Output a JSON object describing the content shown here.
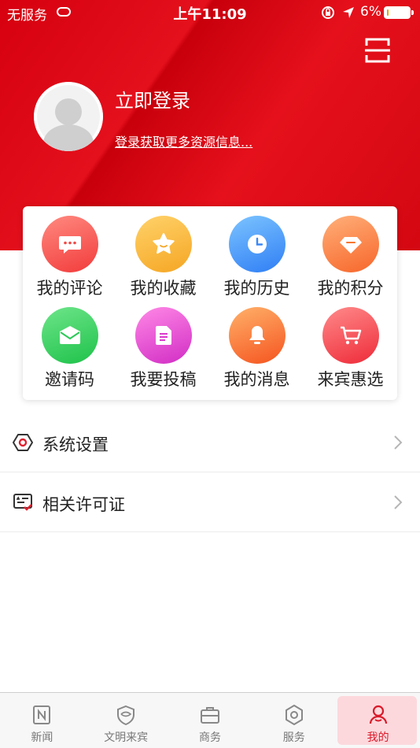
{
  "status_bar": {
    "carrier": "无服务",
    "time": "上午11:09",
    "battery": "6%",
    "battery_level": 0.06
  },
  "header": {
    "login_title": "立即登录",
    "login_subtitle": "登录获取更多资源信息...",
    "scan_icon": "scan-icon",
    "avatar_icon": "default-avatar-icon"
  },
  "shortcuts": [
    {
      "label": "我的评论",
      "icon": "comment-icon",
      "colors": [
        "#ff8a80",
        "#f23b3b"
      ]
    },
    {
      "label": "我的收藏",
      "icon": "star-icon",
      "colors": [
        "#ffd26a",
        "#f5a623"
      ]
    },
    {
      "label": "我的历史",
      "icon": "clock-icon",
      "colors": [
        "#7cc4ff",
        "#2f7ef5"
      ]
    },
    {
      "label": "我的积分",
      "icon": "diamond-icon",
      "colors": [
        "#ffb07a",
        "#f7662a"
      ]
    },
    {
      "label": "邀请码",
      "icon": "envelope-icon",
      "colors": [
        "#6ee58a",
        "#1ec24a"
      ]
    },
    {
      "label": "我要投稿",
      "icon": "document-icon",
      "colors": [
        "#ff88e6",
        "#d12dc4"
      ]
    },
    {
      "label": "我的消息",
      "icon": "bell-icon",
      "colors": [
        "#ffb16a",
        "#f5541f"
      ]
    },
    {
      "label": "来宾惠选",
      "icon": "cart-icon",
      "colors": [
        "#ff8a8a",
        "#ee2b39"
      ]
    }
  ],
  "menu": [
    {
      "label": "系统设置",
      "icon": "settings-hexagon-icon"
    },
    {
      "label": "相关许可证",
      "icon": "license-icon"
    }
  ],
  "tabs": [
    {
      "label": "新闻",
      "icon": "news-icon",
      "active": false
    },
    {
      "label": "文明来宾",
      "icon": "shield-icon",
      "active": false
    },
    {
      "label": "商务",
      "icon": "briefcase-icon",
      "active": false
    },
    {
      "label": "服务",
      "icon": "service-hexagon-icon",
      "active": false
    },
    {
      "label": "我的",
      "icon": "user-icon",
      "active": true
    }
  ],
  "colors": {
    "brand_red": "#d6000f",
    "active_tab": "#d91a2a",
    "active_tab_bg": "#fcd8dc"
  }
}
